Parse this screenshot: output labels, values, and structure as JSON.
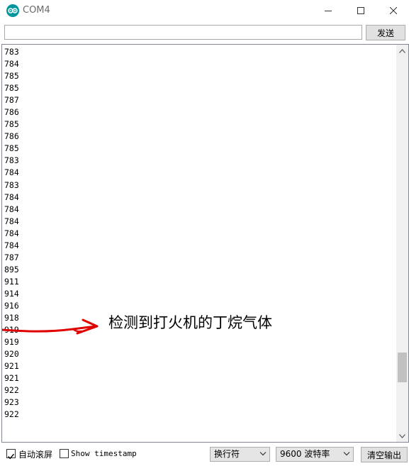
{
  "window": {
    "title": "COM4",
    "icon": "arduino-icon"
  },
  "toolbar": {
    "input_value": "",
    "send_label": "发送"
  },
  "output": {
    "lines": [
      "783",
      "784",
      "785",
      "785",
      "787",
      "786",
      "785",
      "786",
      "785",
      "783",
      "784",
      "783",
      "784",
      "784",
      "784",
      "784",
      "784",
      "787",
      "895",
      "911",
      "914",
      "916",
      "918",
      "919",
      "919",
      "920",
      "921",
      "921",
      "922",
      "923",
      "922"
    ]
  },
  "annotation": {
    "text": "检测到打火机的丁烷气体",
    "color": "#e00000"
  },
  "statusbar": {
    "autoscroll_label": "自动滚屏",
    "autoscroll_checked": true,
    "timestamp_label": "Show timestamp",
    "timestamp_checked": false,
    "line_ending": "换行符",
    "baud_rate": "9600 波特率",
    "clear_label": "清空输出"
  }
}
